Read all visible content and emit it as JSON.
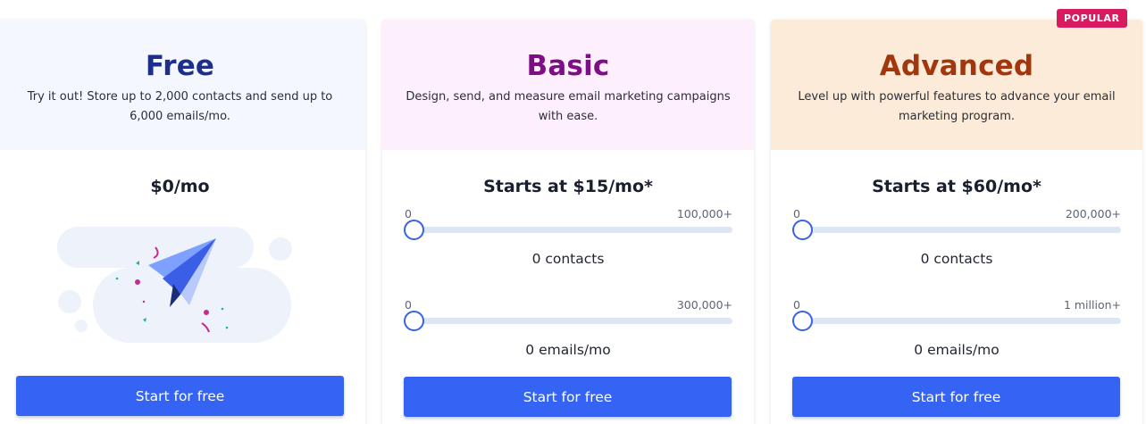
{
  "badge": "POPULAR",
  "plans": {
    "free": {
      "name": "Free",
      "description": "Try it out! Store up to 2,000 contacts and send up to 6,000 emails/mo.",
      "price": "$0/mo",
      "button": "Start for free"
    },
    "basic": {
      "name": "Basic",
      "description": "Design, send, and measure email marketing campaigns with ease.",
      "price": "Starts at $15/mo*",
      "contacts_slider": {
        "min_label": "0",
        "max_label": "100,000+",
        "value_text": "0 contacts",
        "value": 0
      },
      "emails_slider": {
        "min_label": "0",
        "max_label": "300,000+",
        "value_text": "0 emails/mo",
        "value": 0
      },
      "button": "Start for free"
    },
    "advanced": {
      "name": "Advanced",
      "description": "Level up with powerful features to advance your email marketing program.",
      "price": "Starts at $60/mo*",
      "contacts_slider": {
        "min_label": "0",
        "max_label": "200,000+",
        "value_text": "0 contacts",
        "value": 0
      },
      "emails_slider": {
        "min_label": "0",
        "max_label": "1 million+",
        "value_text": "0 emails/mo",
        "value": 0
      },
      "button": "Start for free"
    }
  },
  "colors": {
    "free_title": "#1d2f8c",
    "basic_title": "#7d0f85",
    "advanced_title": "#a3360c",
    "button": "#3564f5",
    "badge": "#d81b60"
  },
  "icons": [
    "paper-plane-icon"
  ]
}
